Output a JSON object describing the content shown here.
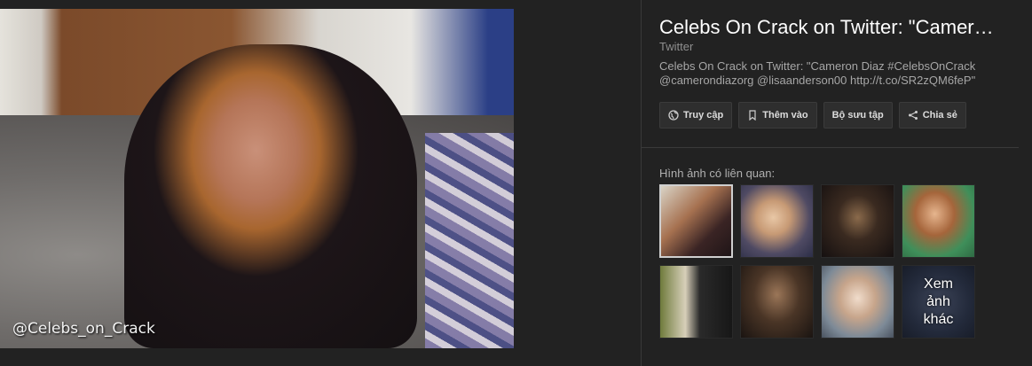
{
  "main_image": {
    "watermark": "@Celebs_on_Crack"
  },
  "panel": {
    "title": "Celebs On Crack on Twitter: \"Camer…",
    "source": "Twitter",
    "description": "Celebs On Crack on Twitter: \"Cameron Diaz #CelebsOnCrack @camerondiazorg @lisaanderson00 http://t.co/SR2zQM6feP\"",
    "actions": [
      {
        "label": "Truy cập",
        "icon": "globe-icon"
      },
      {
        "label": "Thêm vào",
        "icon": "bookmark-icon"
      },
      {
        "label": "Bộ sưu tập",
        "icon": ""
      },
      {
        "label": "Chia sẻ",
        "icon": "share-icon"
      }
    ],
    "related_label": "Hình ảnh có liên quan:",
    "more_label": "Xem ảnh khác"
  },
  "colors": {
    "background": "#222222",
    "title": "#ffffff",
    "muted": "#8f8f8f",
    "button_bg": "#2e2e2e"
  }
}
